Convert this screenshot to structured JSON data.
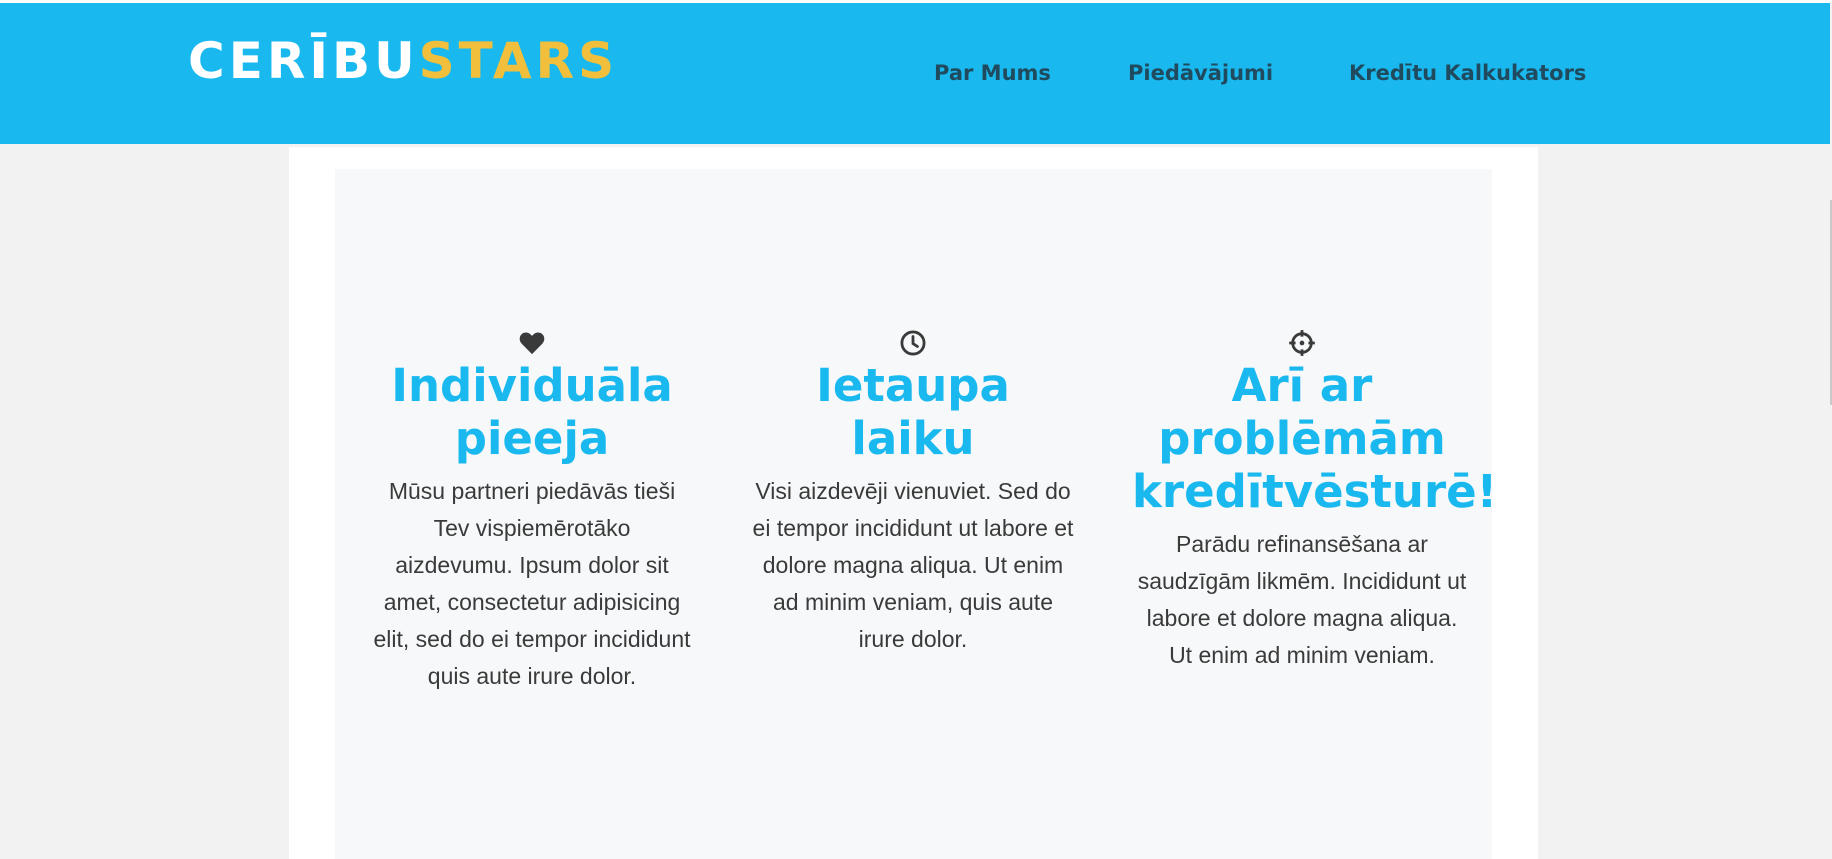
{
  "header": {
    "logo_part1": "CERĪBU",
    "logo_part2": "STARS",
    "nav": [
      {
        "label": "Par Mums"
      },
      {
        "label": "Piedāvājumi"
      },
      {
        "label": "Kredītu Kalkukators"
      }
    ]
  },
  "features": [
    {
      "icon": "heart-icon",
      "title": "Individuāla pieeja",
      "text": "Mūsu partneri piedāvās tieši Tev vispiemērotāko aizdevumu. Ipsum dolor sit amet, consectetur adipisicing elit, sed do ei tempor incididunt quis aute irure dolor."
    },
    {
      "icon": "clock-icon",
      "title": "Ietaupa laiku",
      "text": "Visi aizdevēji vienuviet. Sed do ei tempor incididunt ut labore et dolore magna aliqua. Ut enim ad minim veniam, quis aute irure dolor."
    },
    {
      "icon": "crosshair-icon",
      "title": "Arī ar problēmām kredītvēsturē!",
      "text": "Parādu refinansēšana ar saudzīgām likmēm. Incididunt ut labore et dolore magna aliqua. Ut enim ad minim veniam."
    }
  ],
  "colors": {
    "header_bg": "#19b9ef",
    "logo_accent": "#f1bf3c",
    "nav_text": "#204a5e",
    "title_blue": "#19b9ef",
    "body_text": "#3a3a3a"
  }
}
